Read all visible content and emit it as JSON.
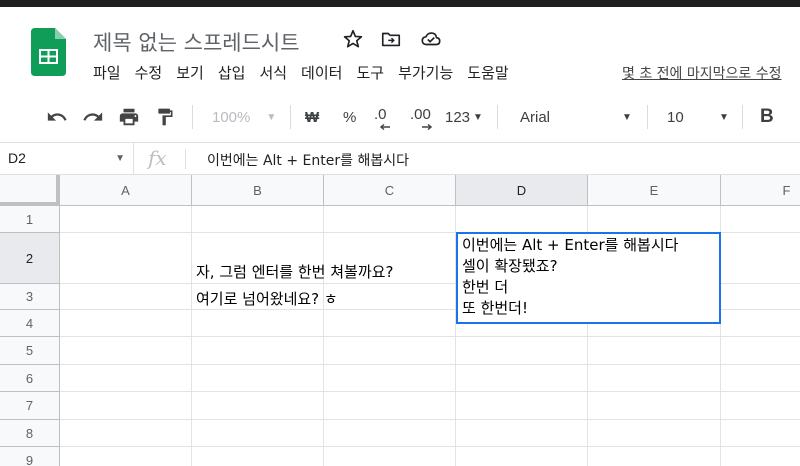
{
  "app": {
    "title": "제목 없는 스프레드시트",
    "menus": [
      "파일",
      "수정",
      "보기",
      "삽입",
      "서식",
      "데이터",
      "도구",
      "부가기능",
      "도움말"
    ],
    "last_edit": "몇 초 전에 마지막으로 수정"
  },
  "toolbar": {
    "zoom": "100%",
    "currency": "₩",
    "percent": "%",
    "dec_less": ".0",
    "dec_more": ".00",
    "more_formats": "123",
    "font": "Arial",
    "font_size": "10",
    "bold": "B"
  },
  "formula_bar": {
    "name_box": "D2",
    "fx": "fx",
    "content": "이번에는 Alt + Enter를 해봅시다"
  },
  "grid": {
    "columns": [
      "A",
      "B",
      "C",
      "D",
      "E",
      "F"
    ],
    "rows": [
      "1",
      "2",
      "3",
      "4",
      "5",
      "6",
      "7",
      "8",
      "9"
    ],
    "selected_col": "D",
    "selected_row": "2",
    "b2": "자, 그럼 엔터를 한번 쳐볼까요?",
    "b3": "여기로 넘어왔네요? ㅎ",
    "d2_lines": [
      "이번에는 Alt + Enter를 해봅시다",
      "셀이 확장됐죠?",
      "한번 더",
      "또 한번더!"
    ]
  },
  "colors": {
    "sheets_green": "#0f9d58",
    "selection_blue": "#1a73e8"
  }
}
